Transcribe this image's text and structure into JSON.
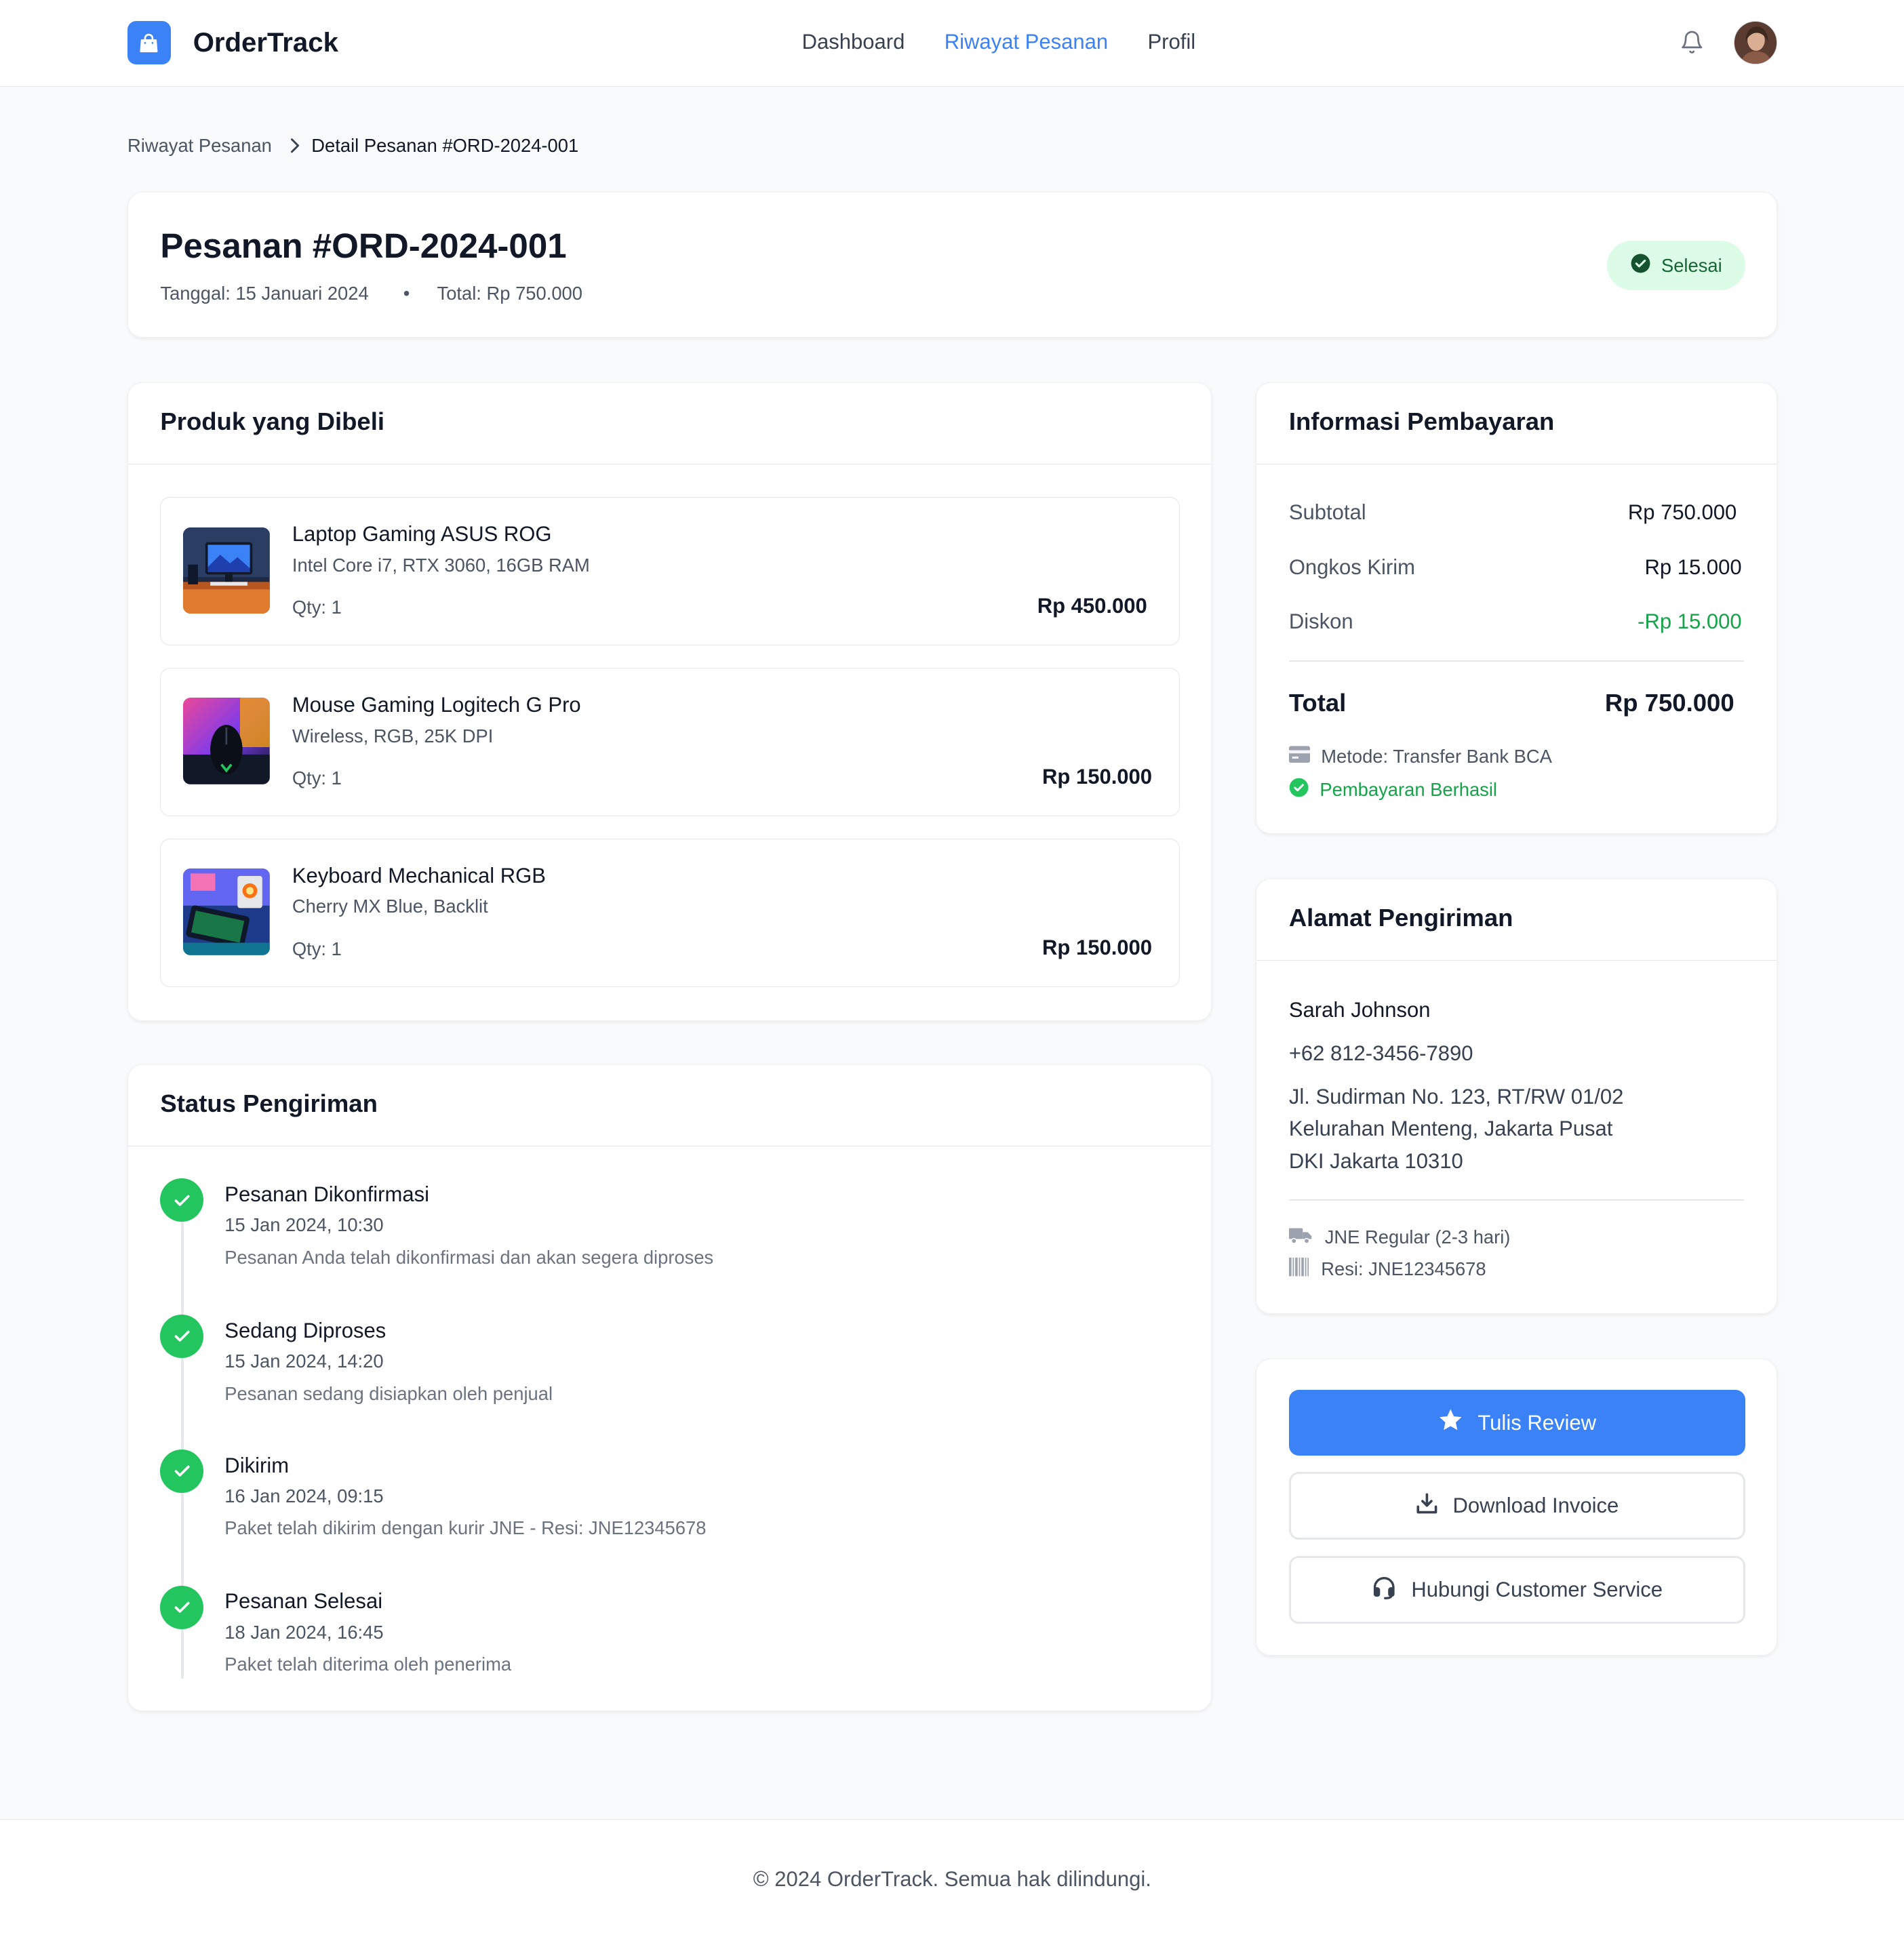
{
  "header": {
    "app_name": "OrderTrack",
    "nav": [
      "Dashboard",
      "Riwayat Pesanan",
      "Profil"
    ],
    "active_nav": "Riwayat Pesanan"
  },
  "breadcrumb": {
    "parent": "Riwayat Pesanan",
    "current": "Detail Pesanan #ORD-2024-001"
  },
  "order": {
    "title": "Pesanan #ORD-2024-001",
    "date": "Tanggal: 15 Januari 2024",
    "separator": "•",
    "total": "Total: Rp 750.000",
    "status": "Selesai"
  },
  "products": {
    "heading": "Produk yang Dibeli",
    "items": [
      {
        "name": "Laptop Gaming ASUS ROG",
        "spec": "Intel Core i7, RTX 3060, 16GB RAM",
        "qty": "Qty: 1",
        "price": "Rp 450.000"
      },
      {
        "name": "Mouse Gaming Logitech G Pro",
        "spec": "Wireless, RGB, 25K DPI",
        "qty": "Qty: 1",
        "price": "Rp 150.000"
      },
      {
        "name": "Keyboard Mechanical RGB",
        "spec": "Cherry MX Blue, Backlit",
        "qty": "Qty: 1",
        "price": "Rp 150.000"
      }
    ]
  },
  "shipping_status": {
    "heading": "Status Pengiriman",
    "steps": [
      {
        "title": "Pesanan Dikonfirmasi",
        "time": "15 Jan 2024, 10:30",
        "desc": "Pesanan Anda telah dikonfirmasi dan akan segera diproses"
      },
      {
        "title": "Sedang Diproses",
        "time": "15 Jan 2024, 14:20",
        "desc": "Pesanan sedang disiapkan oleh penjual"
      },
      {
        "title": "Dikirim",
        "time": "16 Jan 2024, 09:15",
        "desc": "Paket telah dikirim dengan kurir JNE - Resi: JNE12345678"
      },
      {
        "title": "Pesanan Selesai",
        "time": "18 Jan 2024, 16:45",
        "desc": "Paket telah diterima oleh penerima"
      }
    ]
  },
  "payment": {
    "heading": "Informasi Pembayaran",
    "rows": [
      {
        "label": "Subtotal",
        "value": "Rp 750.000"
      },
      {
        "label": "Ongkos Kirim",
        "value": "Rp 15.000"
      },
      {
        "label": "Diskon",
        "value": "-Rp 15.000"
      }
    ],
    "total_label": "Total",
    "total_value": "Rp 750.000",
    "method": "Metode: Transfer Bank BCA",
    "status": "Pembayaran Berhasil"
  },
  "address": {
    "heading": "Alamat Pengiriman",
    "name": "Sarah Johnson",
    "phone": "+62 812-3456-7890",
    "line1": "Jl. Sudirman No. 123, RT/RW 01/02",
    "line2": "Kelurahan Menteng, Jakarta Pusat",
    "line3": "DKI Jakarta 10310",
    "courier": "JNE Regular (2-3 hari)",
    "tracking": "Resi: JNE12345678"
  },
  "actions": {
    "review": "Tulis Review",
    "invoice": "Download Invoice",
    "support": "Hubungi Customer Service"
  },
  "footer": {
    "text": "© 2024 OrderTrack. Semua hak dilindungi."
  },
  "colors": {
    "accent": "#3b82f6",
    "success": "#22c55e",
    "success_text": "#16a34a",
    "badge_bg": "#dcfce7"
  },
  "icons": {
    "brand": "shopping-bag-icon",
    "notifications": "bell-icon",
    "payment_method": "credit-card-icon",
    "payment_status": "check-circle-icon",
    "courier": "truck-icon",
    "tracking": "barcode-icon",
    "review": "star-icon",
    "invoice": "download-icon",
    "support": "headset-icon"
  }
}
